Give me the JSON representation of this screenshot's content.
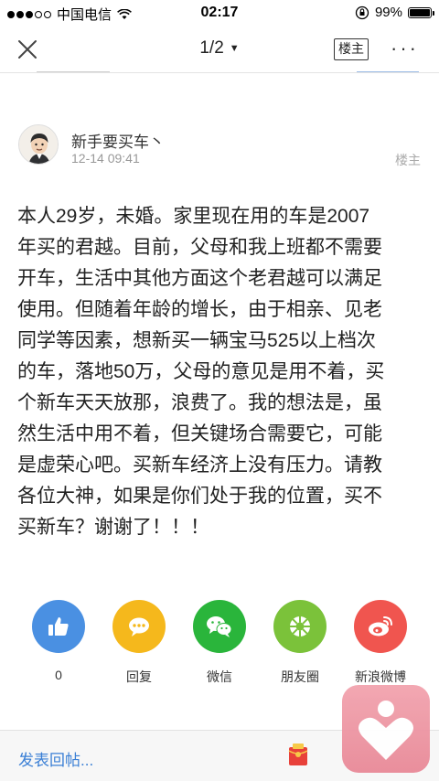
{
  "status_bar": {
    "carrier": "中国电信",
    "time": "02:17",
    "battery": "99%",
    "battery_level": 0.99
  },
  "nav": {
    "page_indicator": "1/2",
    "author_only": "楼主"
  },
  "post": {
    "username": "新手要买车丶",
    "time": "12-14 09:41",
    "floor": "楼主",
    "body_lines": [
      "本人29岁，未婚。家里现在用的车是2007",
      "年买的君越。目前，父母和我上班都不需要",
      "开车，生活中其他方面这个老君越可以满足",
      "使用。但随着年龄的增长，由于相亲、见老",
      "同学等因素，想新买一辆宝马525以上档次",
      "的车，落地50万，父母的意见是用不着，买",
      "个新车天天放那，浪费了。我的想法是，虽",
      "然生活中用不着，但关键场合需要它，可能",
      "是虚荣心吧。买新车经济上没有压力。请教",
      "各位大神，如果是你们处于我的位置，买不",
      "买新车？谢谢了！！！"
    ]
  },
  "share": [
    {
      "label": "0",
      "icon": "thumbs-up-icon",
      "color": "#4a90e2"
    },
    {
      "label": "回复",
      "icon": "chat-bubble-icon",
      "color": "#f5b81c"
    },
    {
      "label": "微信",
      "icon": "wechat-icon",
      "color": "#2ab53b"
    },
    {
      "label": "朋友圈",
      "icon": "moments-icon",
      "color": "#7bc23a"
    },
    {
      "label": "新浪微博",
      "icon": "weibo-icon",
      "color": "#f0554f"
    }
  ],
  "bottom": {
    "reply_prompt": "发表回帖..."
  }
}
